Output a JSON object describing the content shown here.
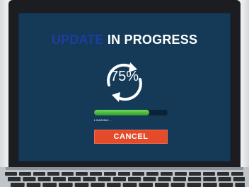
{
  "screen": {
    "heading_faded": "UPDATE",
    "heading_main": "IN PROGRESS",
    "percent": "75%",
    "progress_fraction": 0.75,
    "loading_label": "LOADING...",
    "cancel_label": "CANCEL"
  },
  "colors": {
    "screen_bg": "#143a58",
    "progress_green": "#4cbf3e",
    "cancel_red": "#e44b2b"
  },
  "icons": {
    "refresh": "refresh-arrows-icon"
  }
}
